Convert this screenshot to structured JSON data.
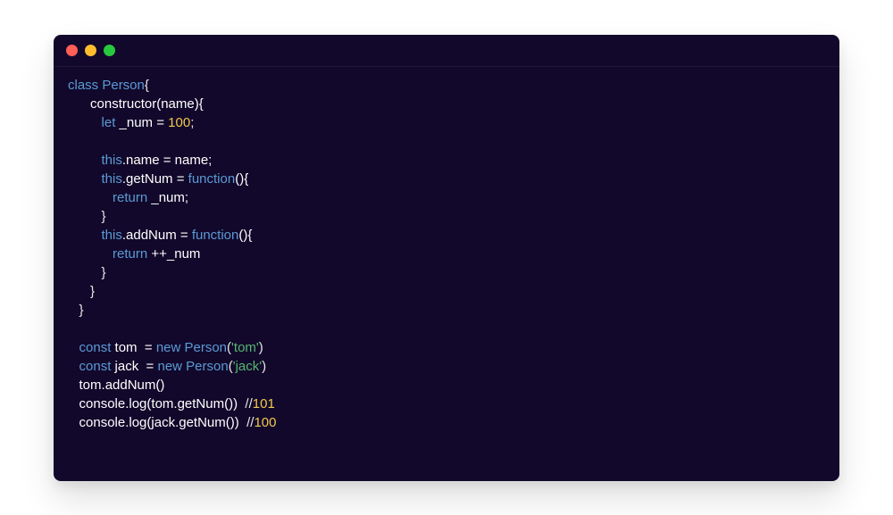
{
  "window": {
    "traffic_lights": [
      "close",
      "minimize",
      "zoom"
    ]
  },
  "code": {
    "lines": [
      [
        {
          "t": "kw",
          "v": "class "
        },
        {
          "t": "cls",
          "v": "Person"
        },
        {
          "t": "op",
          "v": "{"
        }
      ],
      [
        {
          "t": "indent",
          "v": "      "
        },
        {
          "t": "id",
          "v": "constructor(name){"
        }
      ],
      [
        {
          "t": "indent",
          "v": "         "
        },
        {
          "t": "kw",
          "v": "let"
        },
        {
          "t": "id",
          "v": " _num = "
        },
        {
          "t": "num",
          "v": "100"
        },
        {
          "t": "op",
          "v": ";"
        }
      ],
      [
        {
          "t": "blank",
          "v": ""
        }
      ],
      [
        {
          "t": "indent",
          "v": "         "
        },
        {
          "t": "kw",
          "v": "this"
        },
        {
          "t": "id",
          "v": ".name = name;"
        }
      ],
      [
        {
          "t": "indent",
          "v": "         "
        },
        {
          "t": "kw",
          "v": "this"
        },
        {
          "t": "id",
          "v": ".getNum = "
        },
        {
          "t": "kw",
          "v": "function"
        },
        {
          "t": "id",
          "v": "(){"
        }
      ],
      [
        {
          "t": "indent",
          "v": "            "
        },
        {
          "t": "kw",
          "v": "return"
        },
        {
          "t": "id",
          "v": " _num;"
        }
      ],
      [
        {
          "t": "indent",
          "v": "         "
        },
        {
          "t": "op",
          "v": "}"
        }
      ],
      [
        {
          "t": "indent",
          "v": "         "
        },
        {
          "t": "kw",
          "v": "this"
        },
        {
          "t": "id",
          "v": ".addNum = "
        },
        {
          "t": "kw",
          "v": "function"
        },
        {
          "t": "id",
          "v": "(){"
        }
      ],
      [
        {
          "t": "indent",
          "v": "            "
        },
        {
          "t": "kw",
          "v": "return"
        },
        {
          "t": "id",
          "v": " ++_num"
        }
      ],
      [
        {
          "t": "indent",
          "v": "         "
        },
        {
          "t": "op",
          "v": "}"
        }
      ],
      [
        {
          "t": "indent",
          "v": "      "
        },
        {
          "t": "op",
          "v": "}"
        }
      ],
      [
        {
          "t": "indent",
          "v": "   "
        },
        {
          "t": "op",
          "v": "}"
        }
      ],
      [
        {
          "t": "blank",
          "v": ""
        }
      ],
      [
        {
          "t": "indent",
          "v": "   "
        },
        {
          "t": "kw",
          "v": "const"
        },
        {
          "t": "id",
          "v": " tom  = "
        },
        {
          "t": "kw",
          "v": "new "
        },
        {
          "t": "cls",
          "v": "Person"
        },
        {
          "t": "op",
          "v": "("
        },
        {
          "t": "str",
          "v": "'tom'"
        },
        {
          "t": "op",
          "v": ")"
        }
      ],
      [
        {
          "t": "indent",
          "v": "   "
        },
        {
          "t": "kw",
          "v": "const"
        },
        {
          "t": "id",
          "v": " jack  = "
        },
        {
          "t": "kw",
          "v": "new "
        },
        {
          "t": "cls",
          "v": "Person"
        },
        {
          "t": "op",
          "v": "("
        },
        {
          "t": "str",
          "v": "'jack'"
        },
        {
          "t": "op",
          "v": ")"
        }
      ],
      [
        {
          "t": "indent",
          "v": "   "
        },
        {
          "t": "id",
          "v": "tom.addNum()"
        }
      ],
      [
        {
          "t": "indent",
          "v": "   "
        },
        {
          "t": "id",
          "v": "console.log(tom.getNum())  "
        },
        {
          "t": "cmt",
          "v": "//"
        },
        {
          "t": "num",
          "v": "101"
        }
      ],
      [
        {
          "t": "indent",
          "v": "   "
        },
        {
          "t": "id",
          "v": "console.log(jack.getNum())  "
        },
        {
          "t": "cmt",
          "v": "//"
        },
        {
          "t": "num",
          "v": "100"
        }
      ]
    ]
  }
}
